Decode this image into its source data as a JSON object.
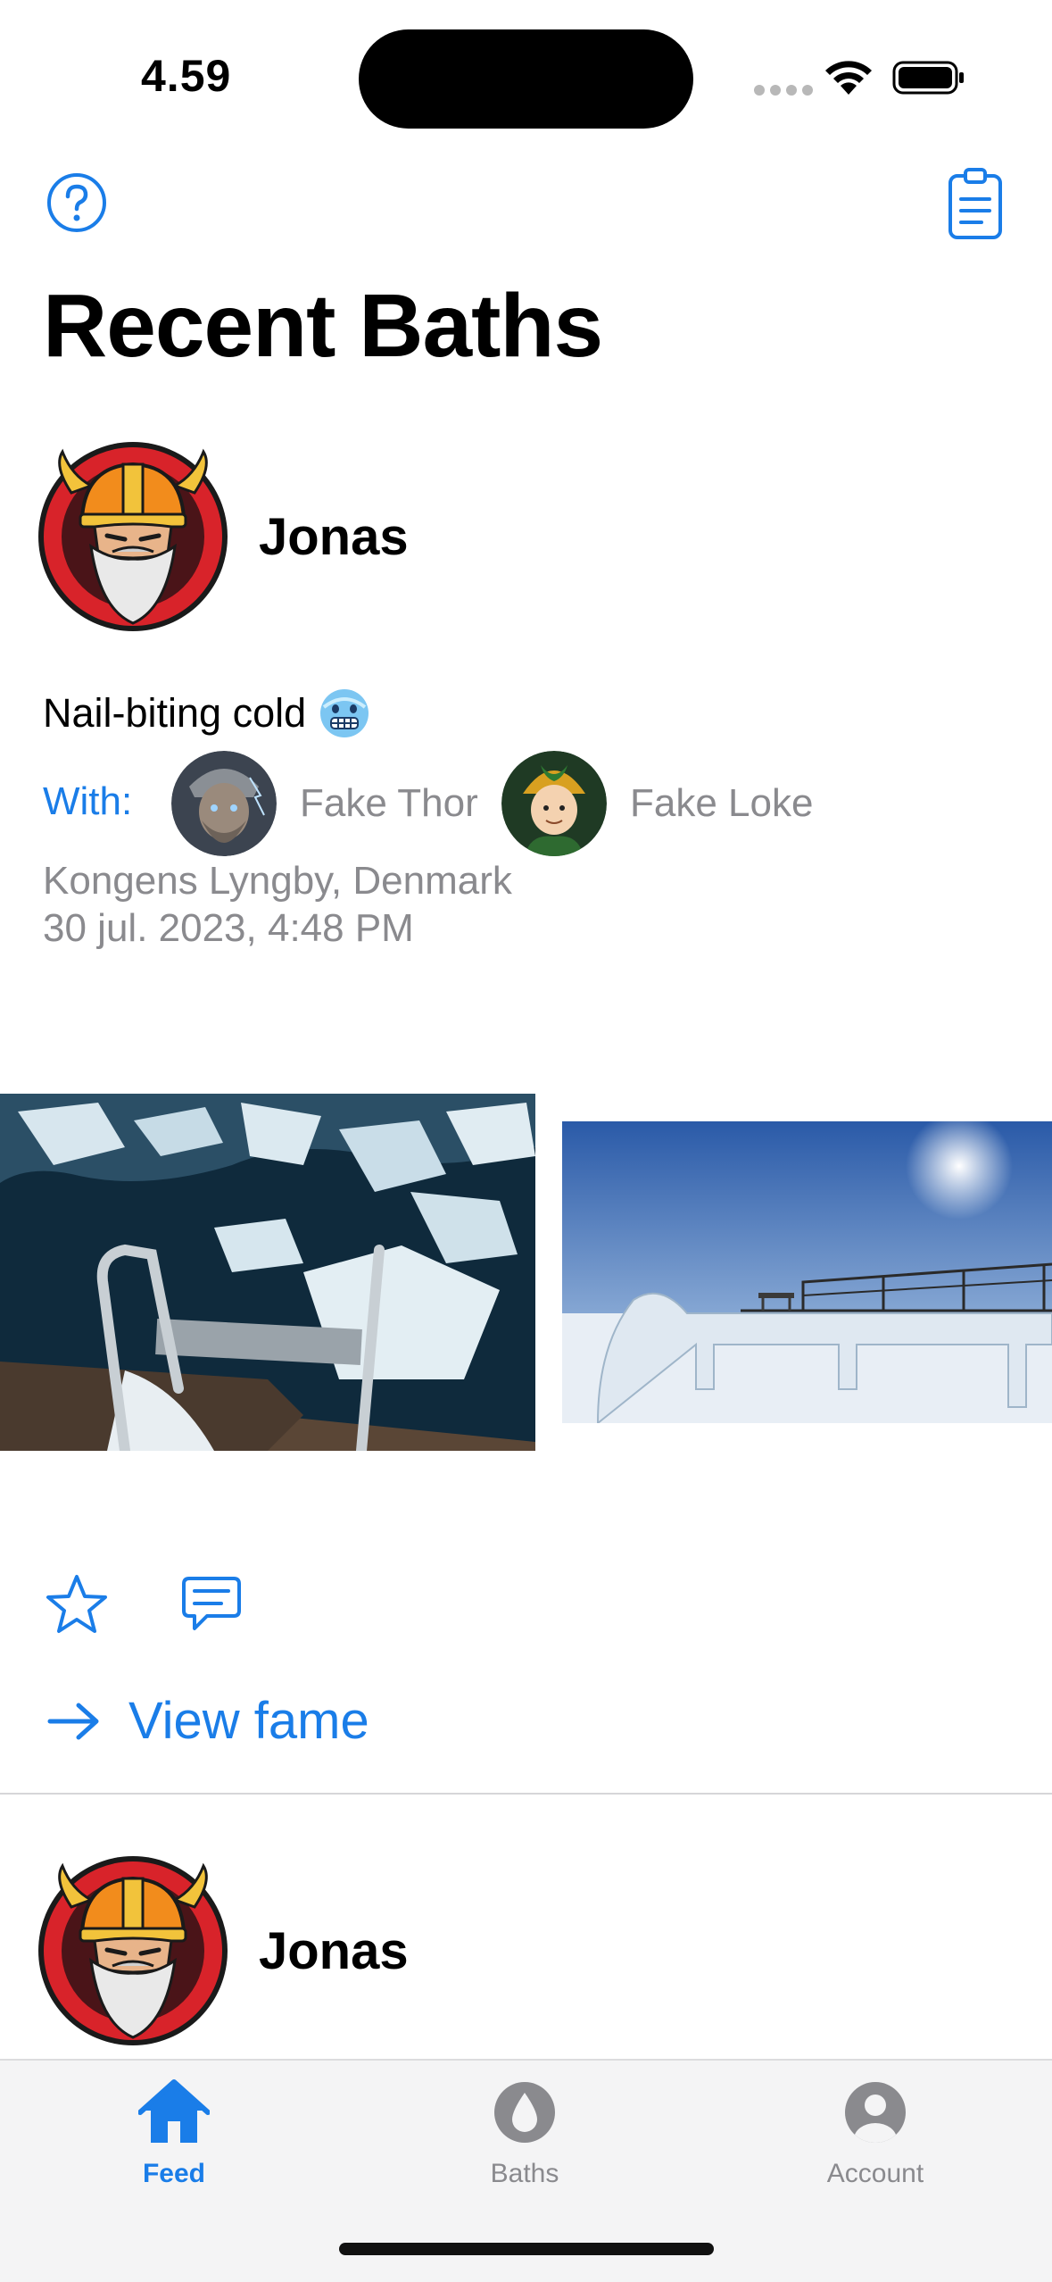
{
  "status_bar": {
    "time": "4.59"
  },
  "header": {
    "title": "Recent Baths"
  },
  "posts": [
    {
      "author": "Jonas",
      "feeling": "Nail-biting cold",
      "with_label": "With:",
      "companions": [
        {
          "name": "Fake Thor"
        },
        {
          "name": "Fake Loke"
        }
      ],
      "location": "Kongens Lyngby, Denmark",
      "datetime": "30 jul. 2023, 4:48 PM",
      "view_fame_label": "View fame"
    },
    {
      "author": "Jonas"
    }
  ],
  "tabs": [
    {
      "label": "Feed",
      "icon": "house-icon",
      "active": true
    },
    {
      "label": "Baths",
      "icon": "drop-icon",
      "active": false
    },
    {
      "label": "Account",
      "icon": "person-icon",
      "active": false
    }
  ],
  "colors": {
    "accent": "#1a7de8",
    "secondary_text": "#8a8a8e",
    "tab_bar_bg": "#f4f4f5"
  }
}
